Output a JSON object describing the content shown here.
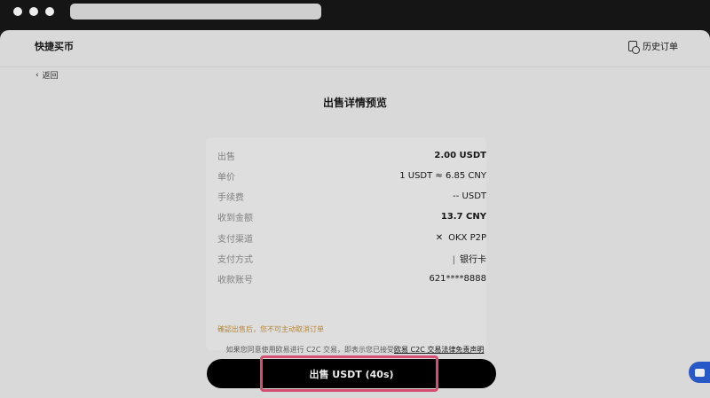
{
  "header": {
    "brand": "快捷买币",
    "history_label": "历史订单"
  },
  "nav": {
    "back_label": "返回"
  },
  "page": {
    "title": "出售详情预览"
  },
  "details": [
    {
      "label": "出售",
      "value": "2.00 USDT",
      "bold": true
    },
    {
      "label": "单价",
      "value": "1 USDT ≈ 6.85 CNY",
      "bold": false
    },
    {
      "label": "手续费",
      "value": "-- USDT",
      "bold": false
    },
    {
      "label": "收到金额",
      "value": "13.7 CNY",
      "bold": true
    },
    {
      "label": "支付渠道",
      "value": "OKX P2P",
      "bold": false
    },
    {
      "label": "支付方式",
      "value": "银行卡",
      "bold": false
    },
    {
      "label": "收款账号",
      "value": "621****8888",
      "bold": false
    }
  ],
  "warning": "確認出售后，您不可主动取消订单",
  "disclaimer": {
    "prefix": "如果您同意使用欧易进行 C2C 交易，即表示您已接受",
    "link": "欧易 C2C 交易法律免责声明"
  },
  "cta": {
    "label": "出售 USDT (40s)"
  },
  "colors": {
    "warning": "#c19243",
    "highlight": "#e5557c",
    "chat": "#2c5fd9"
  }
}
